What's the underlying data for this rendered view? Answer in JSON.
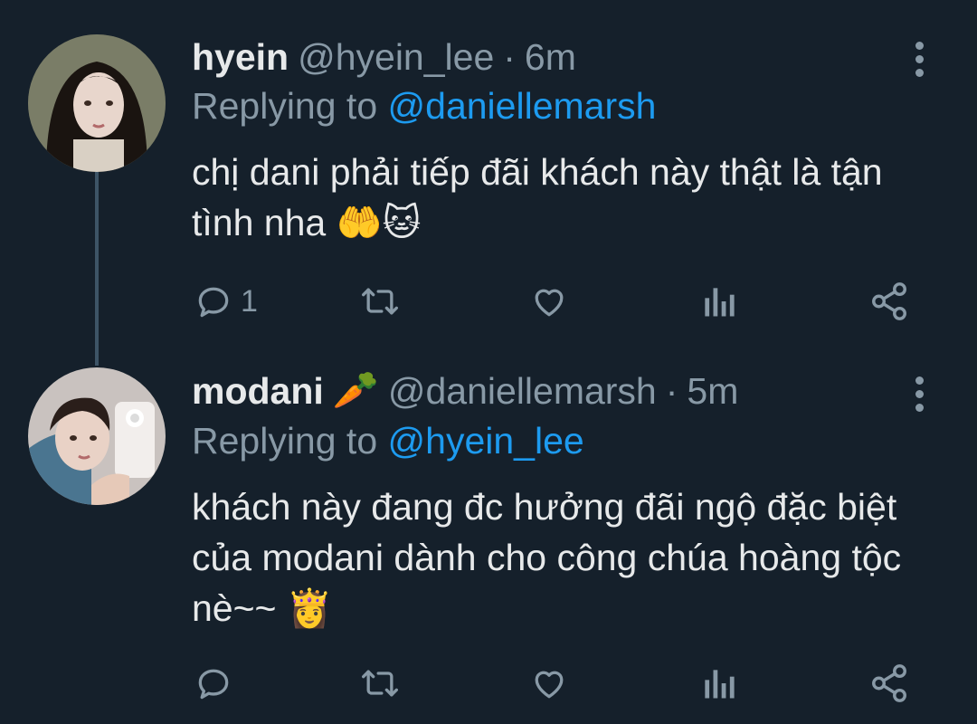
{
  "tweets": [
    {
      "name": "hyein",
      "handle": "@hyein_lee",
      "separator": "·",
      "time": "6m",
      "replying_prefix": "Replying to",
      "replying_to": "@daniellemarsh",
      "text": "chị dani phải tiếp đãi khách này thật là tận tình nha 🤲🐱",
      "reply_count": "1"
    },
    {
      "name": "modani",
      "name_emoji": "🥕",
      "handle": "@daniellemarsh",
      "separator": "·",
      "time": "5m",
      "replying_prefix": "Replying to",
      "replying_to": "@hyein_lee",
      "text": "khách này đang đc hưởng đãi ngộ đặc biệt của modani dành cho công chúa hoàng tộc nè~~ 👸",
      "reply_count": ""
    }
  ],
  "icons": {
    "reply": "reply-icon",
    "retweet": "retweet-icon",
    "like": "heart-icon",
    "analytics": "analytics-icon",
    "share": "share-icon",
    "more": "more-vertical-icon"
  },
  "colors": {
    "background": "#15202b",
    "secondary_text": "#8899a6",
    "mention": "#1d9bf0",
    "thread_line": "#3d5466"
  }
}
